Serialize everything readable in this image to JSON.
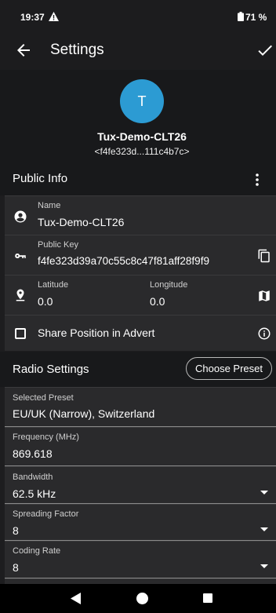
{
  "status_bar": {
    "time": "19:37",
    "battery": "71 %",
    "icons": [
      "warning-icon",
      "battery-icon"
    ]
  },
  "app_bar": {
    "title": "Settings",
    "icons": [
      "arrow-back-icon",
      "check-icon"
    ]
  },
  "device": {
    "avatar_letter": "T",
    "avatar_color": "#2c9bd3",
    "name": "Tux-Demo-CLT26",
    "id": "<f4fe323d...111c4b7c>"
  },
  "public_info": {
    "title": "Public Info",
    "name_label": "Name",
    "name_value": "Tux-Demo-CLT26",
    "key_label": "Public Key",
    "key_value": "f4fe323d39a70c55c8c47f81aff28f9f9",
    "lat_label": "Latitude",
    "lat_value": "0.0",
    "lon_label": "Longitude",
    "lon_value": "0.0",
    "share_label": "Share Position in Advert",
    "share_checked": false
  },
  "radio_settings": {
    "title": "Radio Settings",
    "choose_preset": "Choose Preset",
    "preset_label": "Selected Preset",
    "preset_value": "EU/UK (Narrow), Switzerland",
    "freq_label": "Frequency (MHz)",
    "freq_value": "869.618",
    "bw_label": "Bandwidth",
    "bw_value": "62.5 kHz",
    "sf_label": "Spreading Factor",
    "sf_value": "8",
    "cr_label": "Coding Rate",
    "cr_value": "8"
  },
  "nav_bar": {
    "icons": [
      "nav-back-icon",
      "nav-home-icon",
      "nav-recents-icon"
    ]
  }
}
